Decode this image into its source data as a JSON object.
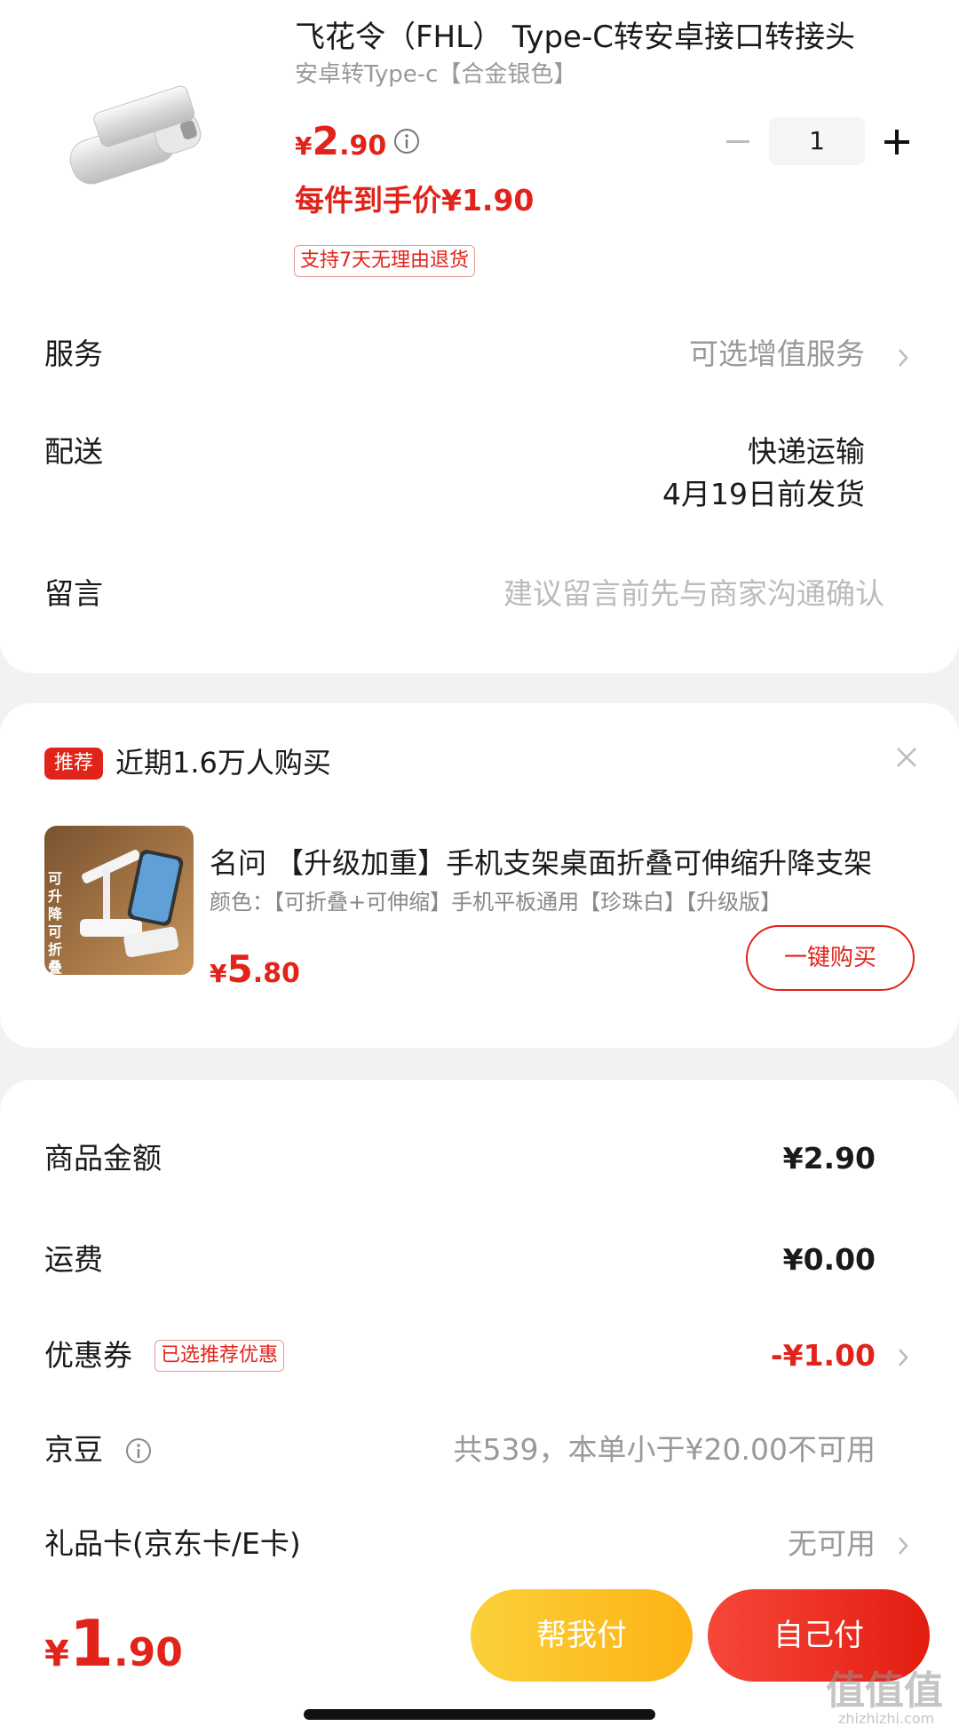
{
  "product": {
    "title": "飞花令（FHL） Type-C转安卓接口转接头",
    "spec": "安卓转Type-c【合金银色】",
    "price_currency": "¥",
    "price_int": "2",
    "price_dec": ".90",
    "final_price": "每件到手价¥1.90",
    "return_tag": "支持7天无理由退货",
    "quantity": "1"
  },
  "service": {
    "label": "服务",
    "value": "可选增值服务"
  },
  "delivery": {
    "label": "配送",
    "method": "快递运输",
    "date": "4月19日前发货"
  },
  "message": {
    "label": "留言",
    "placeholder": "建议留言前先与商家沟通确认"
  },
  "recommend": {
    "badge": "推荐",
    "title": "近期1.6万人购买",
    "image_text": "可升降可折叠",
    "name": "名问 【升级加重】手机支架桌面折叠可伸缩升降支架",
    "spec": "颜色：【可折叠+可伸缩】手机平板通用【珍珠白】【升级版】",
    "price_currency": "¥",
    "price_int": "5",
    "price_dec": ".80",
    "button": "一键购买"
  },
  "summary": {
    "goods_label": "商品金额",
    "goods_value": "¥2.90",
    "shipping_label": "运费",
    "shipping_value": "¥0.00",
    "coupon_label": "优惠券",
    "coupon_tag": "已选推荐优惠",
    "coupon_value": "-¥1.00",
    "jd_bean_label": "京豆",
    "jd_bean_value": "共539，本单小于¥20.00不可用",
    "gift_card_label": "礼品卡(京东卡/E卡)",
    "gift_card_value": "无可用"
  },
  "footer": {
    "total_currency": "¥",
    "total_int": "1",
    "total_dec": ".90",
    "help_pay": "帮我付",
    "self_pay": "自己付"
  },
  "watermark": {
    "main": "值值值",
    "sub": "zhizhizhi.com"
  },
  "colors": {
    "accent": "#e2231a",
    "help_btn": "#fdb314",
    "self_btn": "#e21d10"
  }
}
